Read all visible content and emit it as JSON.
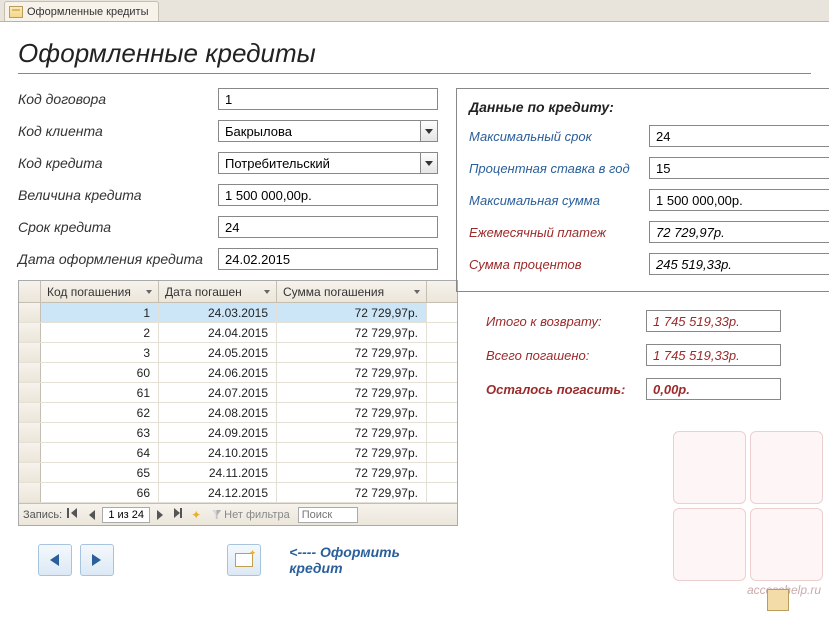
{
  "tab_title": "Оформленные кредиты",
  "page_title": "Оформленные кредиты",
  "fields": {
    "contract_code": {
      "label": "Код договора",
      "value": "1"
    },
    "client_code": {
      "label": "Код клиента",
      "value": "Бакрылова"
    },
    "credit_code": {
      "label": "Код кредита",
      "value": "Потребительский"
    },
    "credit_amount": {
      "label": "Величина кредита",
      "value": "1 500 000,00р."
    },
    "credit_term": {
      "label": "Срок кредита",
      "value": "24"
    },
    "issue_date": {
      "label": "Дата оформления кредита",
      "value": "24.02.2015"
    }
  },
  "panel": {
    "title": "Данные по кредиту:",
    "max_term": {
      "label": "Максимальный срок",
      "value": "24"
    },
    "rate": {
      "label": "Процентная ставка в год",
      "value": "15"
    },
    "max_sum": {
      "label": "Максимальная сумма",
      "value": "1 500 000,00р."
    },
    "monthly": {
      "label": "Ежемесячный платеж",
      "value": "72 729,97р."
    },
    "interest": {
      "label": "Сумма процентов",
      "value": "245 519,33р."
    }
  },
  "summary": {
    "total_due": {
      "label": "Итого к возврату:",
      "value": "1 745 519,33р."
    },
    "paid": {
      "label": "Всего погашено:",
      "value": "1 745 519,33р."
    },
    "remaining": {
      "label": "Осталось погасить:",
      "value": "0,00р."
    }
  },
  "table": {
    "col1": "Код погашения",
    "col2": "Дата погашен",
    "col3": "Сумма погашения",
    "rows": [
      {
        "id": "1",
        "date": "24.03.2015",
        "sum": "72 729,97р."
      },
      {
        "id": "2",
        "date": "24.04.2015",
        "sum": "72 729,97р."
      },
      {
        "id": "3",
        "date": "24.05.2015",
        "sum": "72 729,97р."
      },
      {
        "id": "60",
        "date": "24.06.2015",
        "sum": "72 729,97р."
      },
      {
        "id": "61",
        "date": "24.07.2015",
        "sum": "72 729,97р."
      },
      {
        "id": "62",
        "date": "24.08.2015",
        "sum": "72 729,97р."
      },
      {
        "id": "63",
        "date": "24.09.2015",
        "sum": "72 729,97р."
      },
      {
        "id": "64",
        "date": "24.10.2015",
        "sum": "72 729,97р."
      },
      {
        "id": "65",
        "date": "24.11.2015",
        "sum": "72 729,97р."
      },
      {
        "id": "66",
        "date": "24.12.2015",
        "sum": "72 729,97р."
      }
    ]
  },
  "recnav": {
    "label": "Запись:",
    "position": "1 из 24",
    "filter": "Нет фильтра",
    "search": "Поиск"
  },
  "bottom": {
    "hint": "<---- Оформить кредит"
  },
  "watermark": "accesshelp.ru"
}
